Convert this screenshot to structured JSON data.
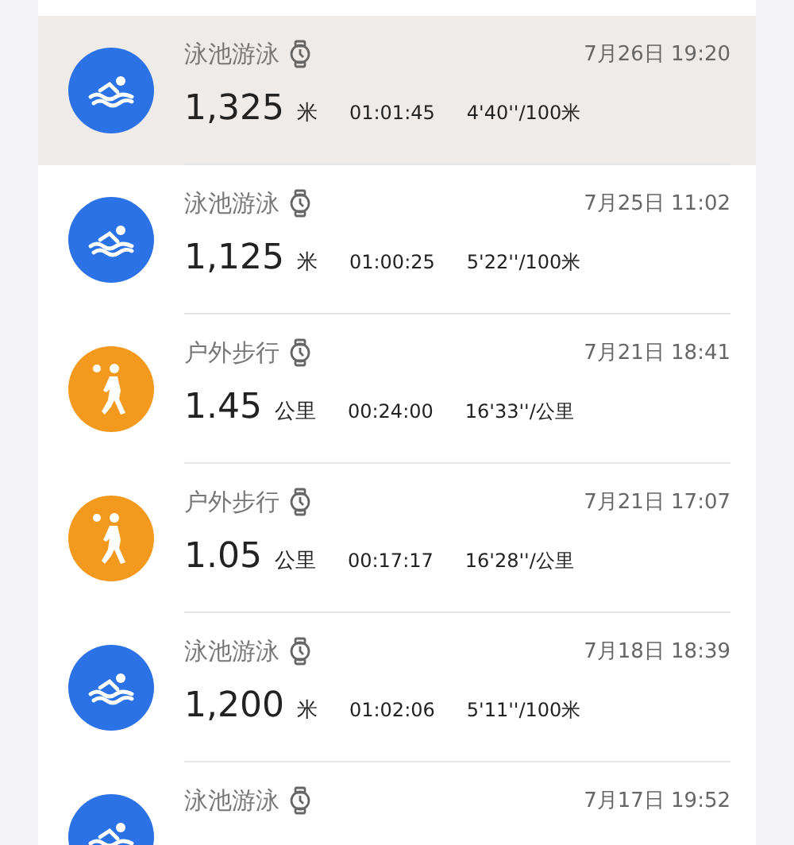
{
  "activities": [
    {
      "kind": "swim",
      "color": "#2a72e5",
      "selected": true,
      "title": "泳池游泳",
      "date": "7月26日 19:20",
      "value": "1,325",
      "unit": "米",
      "duration": "01:01:45",
      "pace": "4'40''/100米"
    },
    {
      "kind": "swim",
      "color": "#2a72e5",
      "selected": false,
      "title": "泳池游泳",
      "date": "7月25日 11:02",
      "value": "1,125",
      "unit": "米",
      "duration": "01:00:25",
      "pace": "5'22''/100米"
    },
    {
      "kind": "walk",
      "color": "#f39a1e",
      "selected": false,
      "title": "户外步行",
      "date": "7月21日 18:41",
      "value": "1.45",
      "unit": "公里",
      "duration": "00:24:00",
      "pace": "16'33''/公里"
    },
    {
      "kind": "walk",
      "color": "#f39a1e",
      "selected": false,
      "title": "户外步行",
      "date": "7月21日 17:07",
      "value": "1.05",
      "unit": "公里",
      "duration": "00:17:17",
      "pace": "16'28''/公里"
    },
    {
      "kind": "swim",
      "color": "#2a72e5",
      "selected": false,
      "title": "泳池游泳",
      "date": "7月18日 18:39",
      "value": "1,200",
      "unit": "米",
      "duration": "01:02:06",
      "pace": "5'11''/100米"
    },
    {
      "kind": "swim",
      "color": "#2a72e5",
      "selected": false,
      "title": "泳池游泳",
      "date": "7月17日 19:52"
    }
  ]
}
